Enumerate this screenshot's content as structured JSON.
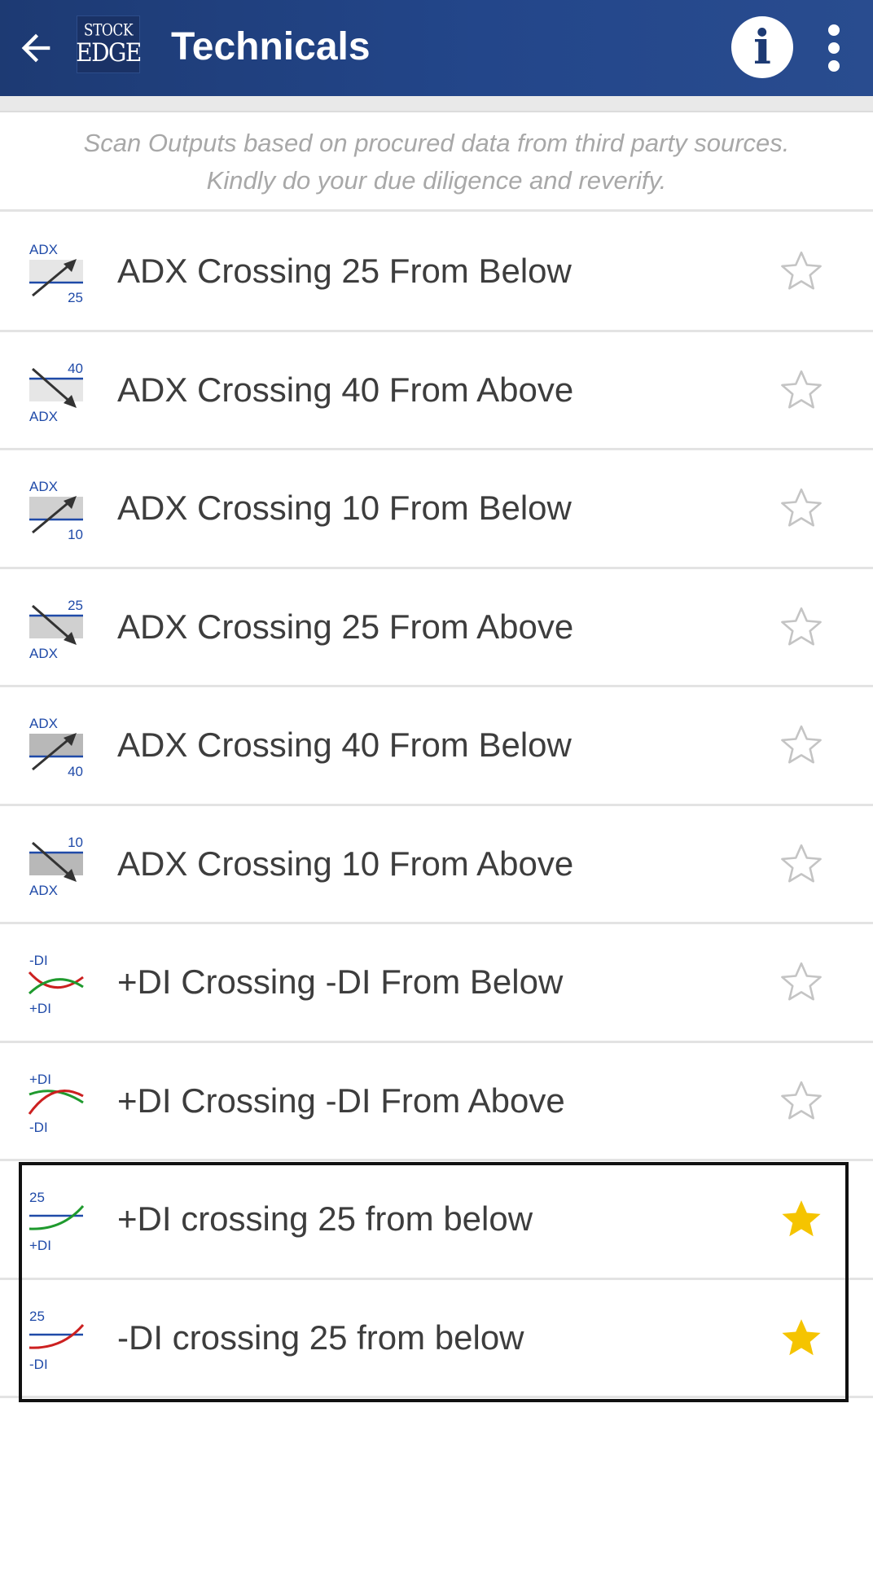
{
  "app_bar": {
    "back_icon": "arrow-left-icon",
    "logo": {
      "line1": "STOCK",
      "line2": "EDGE"
    },
    "title": "Technicals",
    "info_icon": "info-icon",
    "info_glyph": "i",
    "more_icon": "more-vertical-icon"
  },
  "disclaimer": {
    "line1": "Scan Outputs based on procured data from third party sources.",
    "line2": "Kindly do your due diligence and reverify."
  },
  "colors": {
    "app_bar": "#23468a",
    "star_active": "#f5c400",
    "star_inactive": "#c4c4c4",
    "label": "#3d3d3d",
    "icon_blue": "#1f4aa8",
    "icon_green": "#1f9a2e",
    "icon_red": "#cc2020"
  },
  "scans": [
    {
      "label": "ADX Crossing 25 From Below",
      "icon": "adx-cross-up-icon",
      "icon_top": "ADX",
      "icon_bottom": "25",
      "favorite": false
    },
    {
      "label": "ADX Crossing 40 From Above",
      "icon": "adx-cross-down-icon",
      "icon_top": "40",
      "icon_bottom": "ADX",
      "favorite": false
    },
    {
      "label": "ADX Crossing 10 From Below",
      "icon": "adx-cross-up-icon",
      "icon_top": "ADX",
      "icon_bottom": "10",
      "favorite": false
    },
    {
      "label": "ADX Crossing 25 From Above",
      "icon": "adx-cross-down-icon",
      "icon_top": "25",
      "icon_bottom": "ADX",
      "favorite": false
    },
    {
      "label": "ADX Crossing 40 From Below",
      "icon": "adx-cross-up-icon",
      "icon_top": "ADX",
      "icon_bottom": "40",
      "favorite": false
    },
    {
      "label": "ADX Crossing 10 From Above",
      "icon": "adx-cross-down-icon",
      "icon_top": "10",
      "icon_bottom": "ADX",
      "favorite": false
    },
    {
      "label": "+DI Crossing -DI From Below",
      "icon": "di-cross-up-icon",
      "icon_top": "-DI",
      "icon_bottom": "+DI",
      "favorite": false
    },
    {
      "label": "+DI Crossing -DI From Above",
      "icon": "di-cross-down-icon",
      "icon_top": "+DI",
      "icon_bottom": "-DI",
      "favorite": false
    },
    {
      "label": "+DI crossing 25 from below",
      "icon": "plus-di-cross-25-icon",
      "icon_top": "25",
      "icon_bottom": "+DI",
      "favorite": true
    },
    {
      "label": "-DI crossing 25 from below",
      "icon": "minus-di-cross-25-icon",
      "icon_top": "25",
      "icon_bottom": "-DI",
      "favorite": true
    }
  ]
}
